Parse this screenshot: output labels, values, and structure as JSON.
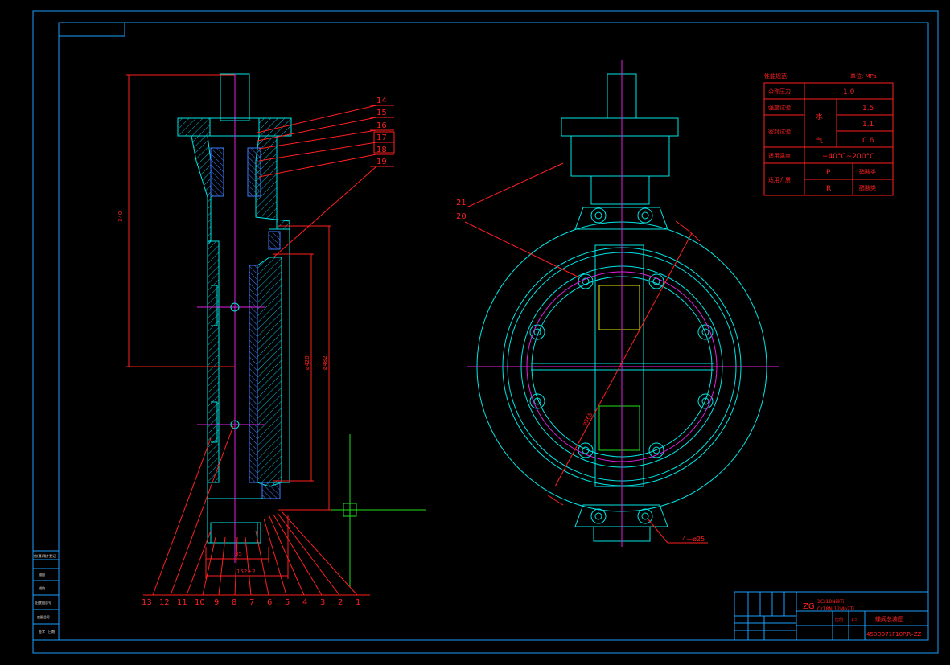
{
  "colors": {
    "frame": "#1aa0ff",
    "cyan": "#00e5e5",
    "red": "#ff2020",
    "magenta": "#e020e0",
    "yellow": "#e6e600",
    "green": "#20e020",
    "white": "#e8e8e8"
  },
  "dimensions": {
    "height_340": "340",
    "dia_420": "ø420",
    "dia_482": "ø482",
    "dia_565": "ø565",
    "width_35": "35",
    "width_152": "152±2",
    "bolts": "4—ø25"
  },
  "part_numbers": [
    "14",
    "15",
    "16",
    "17",
    "18",
    "19",
    "21",
    "20",
    "13",
    "12",
    "11",
    "10",
    "9",
    "8",
    "7",
    "6",
    "5",
    "4",
    "3",
    "2",
    "1"
  ],
  "perf_table": {
    "title": "性能规范:",
    "unit": "单位: MPa",
    "rows": [
      {
        "label": "公称压力",
        "v1": "1.0",
        "v2": "",
        "v3": ""
      },
      {
        "label": "强度试验",
        "v1": "",
        "v2": "1.5",
        "v3": ""
      },
      {
        "label": "密封试验",
        "v1": "水",
        "v2": "1.1",
        "v3": ""
      },
      {
        "label": "",
        "v1": "气",
        "v2": "0.6",
        "v3": ""
      },
      {
        "label": "适用温度",
        "v1": "−40°C~200°C",
        "v2": "",
        "v3": ""
      },
      {
        "label": "适用介质",
        "v1": "P",
        "v2": "",
        "v3": "硝酸类"
      },
      {
        "label": "",
        "v1": "R",
        "v2": "",
        "v3": "醋酸类"
      }
    ]
  },
  "title_block": {
    "material_zg": "ZG",
    "material_1": "1Cr18Ni9Ti",
    "material_2": "Cr18Ni12Mo2Ti",
    "drawing_name": "蝶阀总装图",
    "drawing_no": "450D371F10P.R–ZZ",
    "scale": "比例",
    "sheet": "1:5"
  },
  "side_block": {
    "r1": "借(通)用件登记",
    "r2": "描图",
    "r3": "描校",
    "r4": "旧底图总号",
    "r5": "底图总号",
    "r6": "签字",
    "r7": "日期"
  }
}
